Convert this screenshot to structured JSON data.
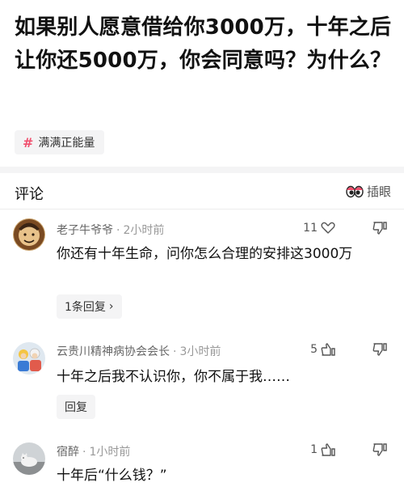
{
  "question": {
    "title": "如果别人愿意借给你3000万，十年之后让你还5000万，你会同意吗？为什么？"
  },
  "topic_tag": {
    "icon": "hash-icon",
    "label": "满满正能量"
  },
  "comments_section": {
    "title": "评论",
    "sort_label": "插眼"
  },
  "comments": [
    {
      "author": "老子牛爷爷",
      "time": "2小时前",
      "likes": "11",
      "text": "你还有十年生命，问你怎么合理的安排这3000万",
      "reply_label": "1条回复"
    },
    {
      "author": "云贵川精神病协会会长",
      "time": "3小时前",
      "likes": "5",
      "text": "十年之后我不认识你，你不属于我……",
      "reply_label": "回复"
    },
    {
      "author": "宿醉",
      "time": "1小时前",
      "likes": "1",
      "text": "十年后“什么钱？”"
    }
  ],
  "colors": {
    "accent": "#f0506e",
    "divider": "#f4f4f5"
  }
}
